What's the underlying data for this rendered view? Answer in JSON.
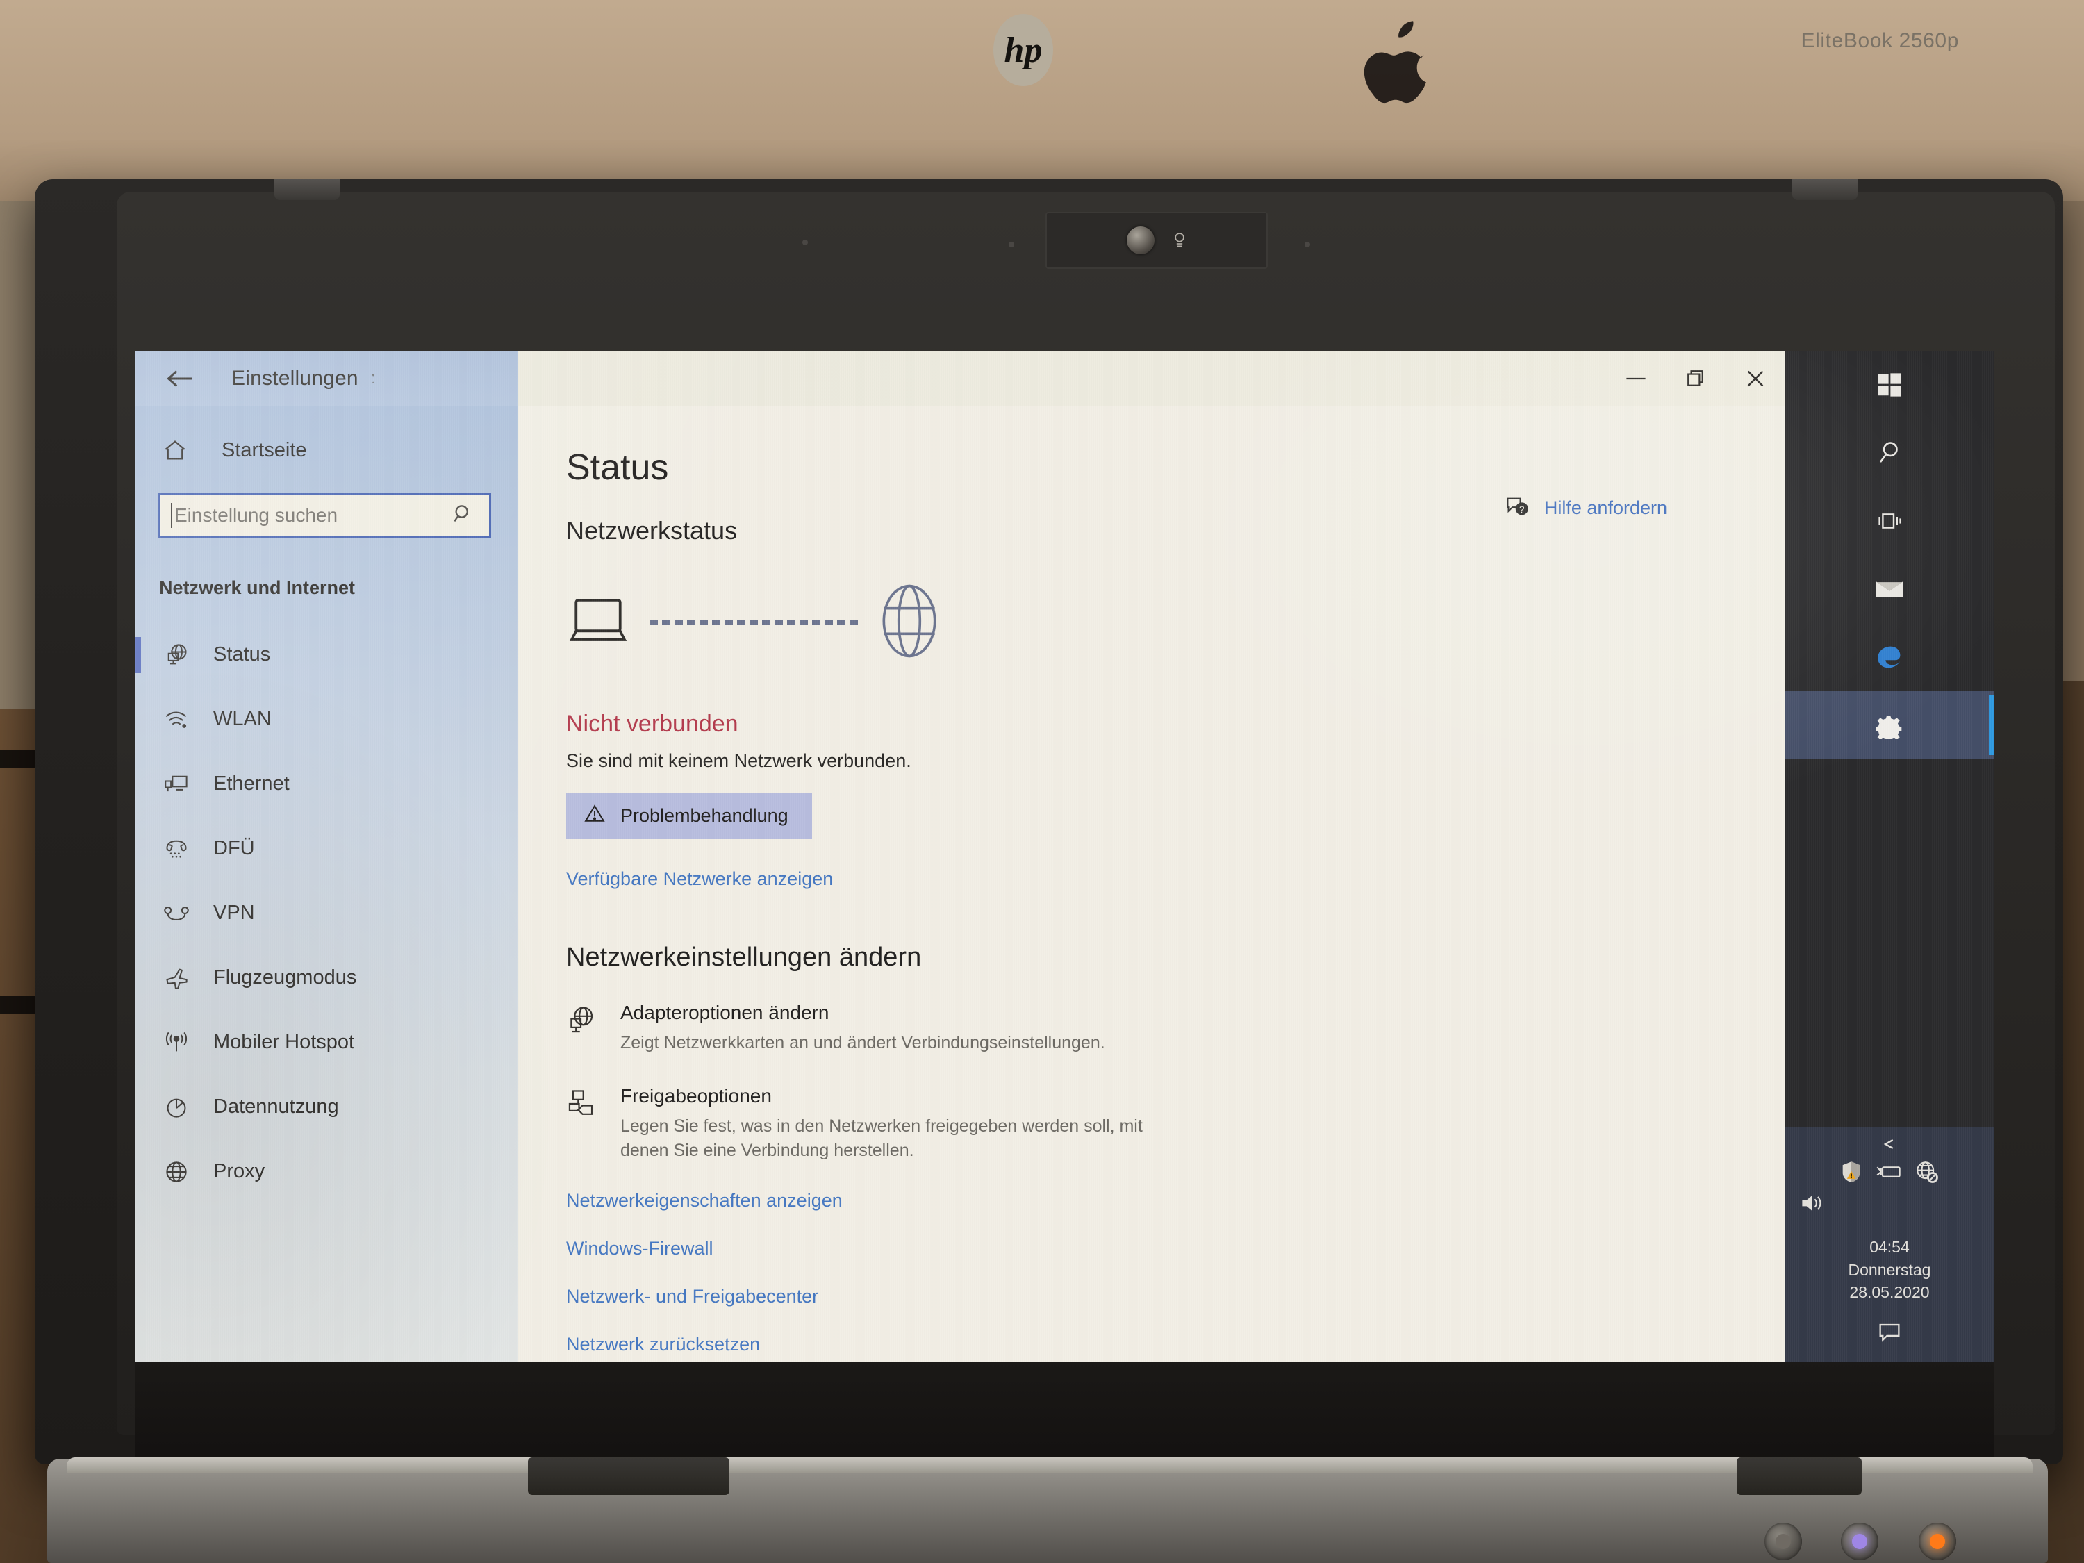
{
  "environment": {
    "background_monitor_brand_icon": "apple-logo",
    "laptop_brand_icon": "hp-logo",
    "laptop_model": "EliteBook 2560p",
    "webcam_icon": "webcam-lens-icon",
    "webcam_light_icon": "lamp-icon"
  },
  "window": {
    "title": "Einstellungen",
    "back_icon": "back-arrow-icon",
    "busy_indicator": "ː",
    "controls": {
      "minimize": "—",
      "restore": "❐",
      "close": "✕"
    }
  },
  "sidebar": {
    "home": {
      "label": "Startseite",
      "icon": "home-icon"
    },
    "search": {
      "placeholder": "Einstellung suchen",
      "icon": "search-icon",
      "value": ""
    },
    "section_label": "Netzwerk und Internet",
    "items": [
      {
        "label": "Status",
        "icon": "globe-monitor-icon",
        "active": true
      },
      {
        "label": "WLAN",
        "icon": "wifi-icon",
        "active": false
      },
      {
        "label": "Ethernet",
        "icon": "ethernet-icon",
        "active": false
      },
      {
        "label": "DFÜ",
        "icon": "dialup-phone-icon",
        "active": false
      },
      {
        "label": "VPN",
        "icon": "vpn-icon",
        "active": false
      },
      {
        "label": "Flugzeugmodus",
        "icon": "airplane-icon",
        "active": false
      },
      {
        "label": "Mobiler Hotspot",
        "icon": "hotspot-icon",
        "active": false
      },
      {
        "label": "Datennutzung",
        "icon": "pie-chart-icon",
        "active": false
      },
      {
        "label": "Proxy",
        "icon": "globe-icon",
        "active": false
      }
    ]
  },
  "main": {
    "page_title": "Status",
    "section_title": "Netzwerkstatus",
    "help_link": {
      "label": "Hilfe anfordern",
      "icon": "help-question-icon"
    },
    "diagram": {
      "device_icon": "laptop-icon",
      "link_style": "dashed-disconnected",
      "internet_icon": "globe-icon"
    },
    "status_headline": "Nicht verbunden",
    "status_description": "Sie sind mit keinem Netzwerk verbunden.",
    "troubleshoot_button": {
      "label": "Problembehandlung",
      "icon": "warning-triangle-icon"
    },
    "available_networks_link": "Verfügbare Netzwerke anzeigen",
    "change_settings_title": "Netzwerkeinstellungen ändern",
    "options": [
      {
        "icon": "adapter-globe-icon",
        "title": "Adapteroptionen ändern",
        "description": "Zeigt Netzwerkkarten an und ändert Verbindungseinstellungen."
      },
      {
        "icon": "sharing-folder-icon",
        "title": "Freigabeoptionen",
        "description": "Legen Sie fest, was in den Netzwerken freigegeben werden soll, mit denen Sie eine Verbindung herstellen."
      }
    ],
    "links": [
      "Netzwerkeigenschaften anzeigen",
      "Windows-Firewall",
      "Netzwerk- und Freigabecenter",
      "Netzwerk zurücksetzen"
    ],
    "cursor_icon": "mouse-pointer-icon"
  },
  "taskbar": {
    "icons": [
      {
        "name": "windows-start-icon",
        "active": false
      },
      {
        "name": "search-icon",
        "active": false
      },
      {
        "name": "task-view-icon",
        "active": false
      },
      {
        "name": "mail-icon",
        "active": false
      },
      {
        "name": "edge-browser-icon",
        "active": false
      },
      {
        "name": "settings-gear-icon",
        "active": true
      }
    ],
    "tray": {
      "chevron_icon": "chevron-up-icon",
      "icons": [
        "security-shield-warning-icon",
        "battery-charging-icon",
        "network-disconnected-globe-icon",
        "volume-icon"
      ],
      "time": "04:54",
      "day": "Donnerstag",
      "date": "28.05.2020",
      "action_center_icon": "action-center-icon"
    }
  },
  "colors": {
    "accent_blue": "#4678c2",
    "error_red": "#b43c4e",
    "sidebar_top": "#aec1db",
    "button_fill": "#b8bdde",
    "selection_indicator": "#5a6fc0",
    "taskbar_bg": "#2a2a2c",
    "tray_bg": "#353a49"
  }
}
